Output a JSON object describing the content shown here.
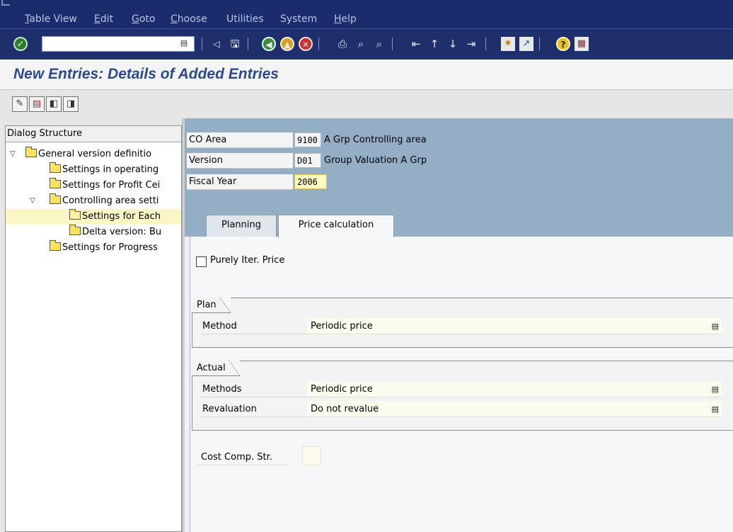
{
  "menu": {
    "items": [
      "Table View",
      "Edit",
      "Goto",
      "Choose",
      "Utilities",
      "System",
      "Help"
    ],
    "underlines": [
      "T",
      "E",
      "G",
      "C",
      "",
      "",
      "H"
    ]
  },
  "toolbar": {
    "command_field_value": "",
    "icons": [
      "ok-check-icon",
      "dropdown-icon",
      "back-arrow-icon",
      "save-icon",
      "back-green-icon",
      "exit-icon",
      "cancel-icon",
      "print-icon",
      "find-icon",
      "find-next-icon",
      "first-page-icon",
      "prev-page-icon",
      "next-page-icon",
      "last-page-icon",
      "new-session-icon",
      "shortcut-icon",
      "help-icon",
      "layout-icon"
    ]
  },
  "page": {
    "title": "New Entries: Details of Added Entries"
  },
  "app_toolbar": {
    "icons": [
      "display-change-icon",
      "delete-icon",
      "previous-entry-icon",
      "next-entry-icon"
    ]
  },
  "nav": {
    "header": "Dialog Structure",
    "items": [
      {
        "label": "General version definitio",
        "level": 0,
        "expanded": true
      },
      {
        "label": "Settings in operating",
        "level": 1
      },
      {
        "label": "Settings for Profit Cei",
        "level": 1
      },
      {
        "label": "Controlling area setti",
        "level": 1,
        "expanded": true
      },
      {
        "label": "Settings for Each",
        "level": 2,
        "selected": true
      },
      {
        "label": "Delta version: Bu",
        "level": 2
      },
      {
        "label": "Settings for Progress",
        "level": 1
      }
    ]
  },
  "header_fields": {
    "co_area": {
      "label": "CO Area",
      "value": "9100",
      "text": "A Grp Controlling area"
    },
    "version": {
      "label": "Version",
      "value": "D01",
      "text": "Group Valuation A Grp"
    },
    "fiscal_year": {
      "label": "Fiscal Year",
      "value": "2006"
    }
  },
  "tabs": [
    {
      "label": "Planning",
      "active": false
    },
    {
      "label": "Price calculation",
      "active": true
    }
  ],
  "price_calc": {
    "purely_iter_price": {
      "label": "Purely Iter. Price",
      "checked": false
    },
    "plan": {
      "title": "Plan",
      "method": {
        "label": "Method",
        "value": "Periodic price"
      }
    },
    "actual": {
      "title": "Actual",
      "methods": {
        "label": "Methods",
        "value": "Periodic price"
      },
      "revaluation": {
        "label": "Revaluation",
        "value": "Do not revalue"
      }
    },
    "cost_comp_str": {
      "label": "Cost Comp. Str.",
      "value": ""
    }
  },
  "colors": {
    "menubar": "#1a2c6b",
    "title": "#2c4a8c",
    "header_block": "#94aec6",
    "selected_nav": "#fbf6c6"
  }
}
